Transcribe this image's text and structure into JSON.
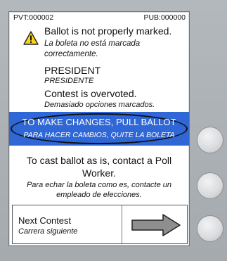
{
  "counters": {
    "pvt": "PVT:000002",
    "pub": "PUB:000000"
  },
  "warning": {
    "icon": "warning-icon",
    "title_en": "Ballot is not properly marked.",
    "title_es": "La boleta no está marcada correctamente."
  },
  "contest": {
    "name_en": "PRESIDENT",
    "name_es": "PRESIDENTE",
    "status_en": "Contest is overvoted.",
    "status_es": "Demasiado opciones marcados."
  },
  "banner": {
    "text_en": "TO MAKE CHANGES, PULL BALLOT",
    "text_es": "PARA HACER CAMBIOS, QUITE LA BOLETA",
    "color": "#2f67d6"
  },
  "cast": {
    "text_en": "To cast ballot as is, contact a Poll Worker.",
    "text_es": "Para echar la boleta como es, contacte un empleado de elecciones."
  },
  "next": {
    "label_en": "Next Contest",
    "label_es": "Carrera siguiente",
    "icon": "right-arrow-icon"
  }
}
